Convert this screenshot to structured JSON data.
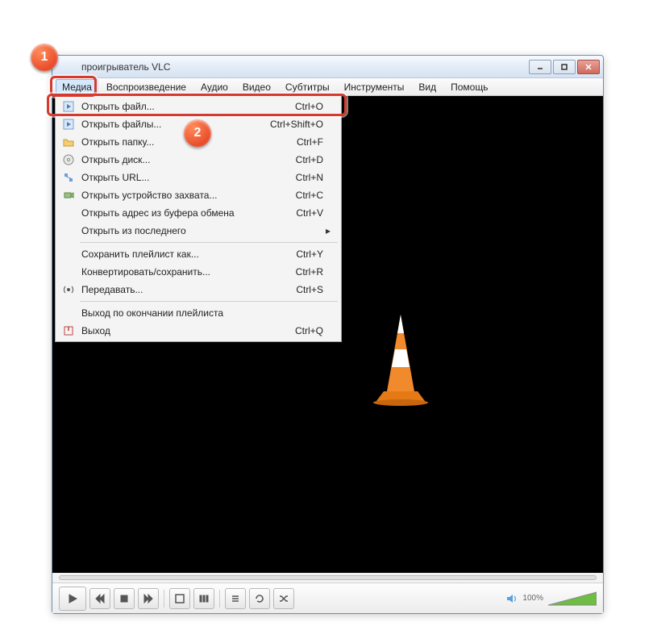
{
  "window": {
    "title": "проигрыватель VLC"
  },
  "menubar": {
    "items": [
      "Медиа",
      "Воспроизведение",
      "Аудио",
      "Видео",
      "Субтитры",
      "Инструменты",
      "Вид",
      "Помощь"
    ]
  },
  "dropdown": {
    "items": [
      {
        "label": "Открыть файл...",
        "shortcut": "Ctrl+O",
        "icon": "play-file"
      },
      {
        "label": "Открыть файлы...",
        "shortcut": "Ctrl+Shift+O",
        "icon": "play-file"
      },
      {
        "label": "Открыть папку...",
        "shortcut": "Ctrl+F",
        "icon": "folder"
      },
      {
        "label": "Открыть диск...",
        "shortcut": "Ctrl+D",
        "icon": "disc"
      },
      {
        "label": "Открыть URL...",
        "shortcut": "Ctrl+N",
        "icon": "network"
      },
      {
        "label": "Открыть устройство захвата...",
        "shortcut": "Ctrl+C",
        "icon": "capture"
      },
      {
        "label": "Открыть адрес из буфера обмена",
        "shortcut": "Ctrl+V",
        "icon": ""
      },
      {
        "label": "Открыть из последнего",
        "shortcut": "",
        "icon": "",
        "submenu": true
      }
    ],
    "items2": [
      {
        "label": "Сохранить плейлист как...",
        "shortcut": "Ctrl+Y",
        "icon": ""
      },
      {
        "label": "Конвертировать/сохранить...",
        "shortcut": "Ctrl+R",
        "icon": ""
      },
      {
        "label": "Передавать...",
        "shortcut": "Ctrl+S",
        "icon": "antenna"
      }
    ],
    "items3": [
      {
        "label": "Выход по окончании плейлиста",
        "shortcut": "",
        "icon": ""
      },
      {
        "label": "Выход",
        "shortcut": "Ctrl+Q",
        "icon": "quit"
      }
    ]
  },
  "controls": {
    "volume_pct": "100%"
  },
  "callouts": {
    "b1": "1",
    "b2": "2"
  }
}
